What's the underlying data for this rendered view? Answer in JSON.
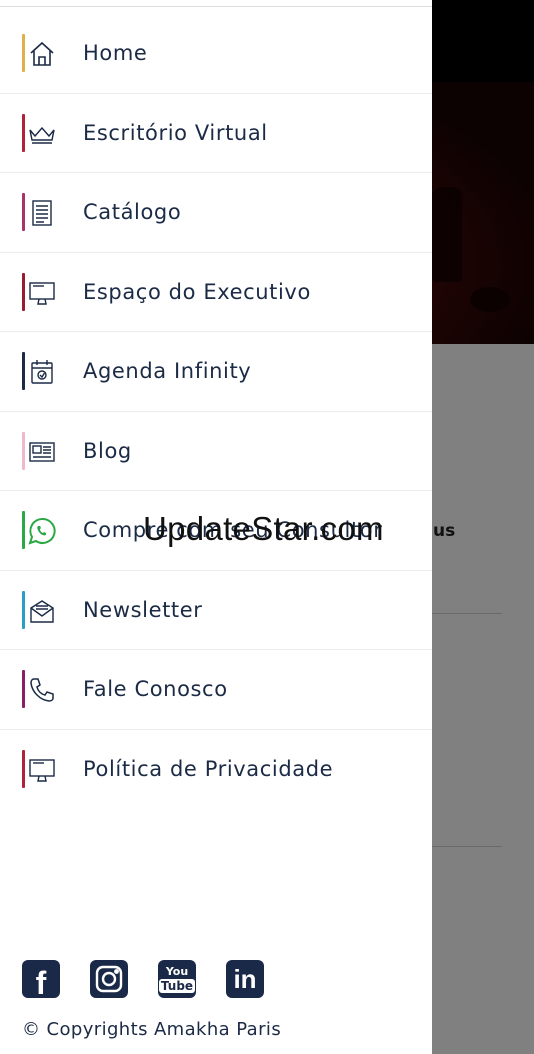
{
  "menu": {
    "items": [
      {
        "label": "Home",
        "icon": "home-icon",
        "color": "#e2b04a"
      },
      {
        "label": "Escritório Virtual",
        "icon": "crown-icon",
        "color": "#b0223a"
      },
      {
        "label": "Catálogo",
        "icon": "catalog-icon",
        "color": "#a8336a"
      },
      {
        "label": "Espaço do Executivo",
        "icon": "monitor-icon",
        "color": "#9b1a2e"
      },
      {
        "label": "Agenda Infinity",
        "icon": "calendar-icon",
        "color": "#1b2a45"
      },
      {
        "label": "Blog",
        "icon": "newspaper-icon",
        "color": "#f0b8cc"
      },
      {
        "label": "Compre com seu Consultor",
        "icon": "whatsapp-icon",
        "color": "#2aa845"
      },
      {
        "label": "Newsletter",
        "icon": "envelope-icon",
        "color": "#2a9fc4"
      },
      {
        "label": "Fale Conosco",
        "icon": "phone-icon",
        "color": "#8a1e6a"
      },
      {
        "label": "Política de Privacidade",
        "icon": "monitor-icon",
        "color": "#b0223a"
      }
    ]
  },
  "social": {
    "icons": [
      "facebook-icon",
      "instagram-icon",
      "youtube-icon",
      "linkedin-icon"
    ],
    "youtube_text_top": "You",
    "youtube_text_bottom": "Tube",
    "linkedin_text": "in",
    "facebook_text": "f"
  },
  "footer": {
    "copyright": "© Copyrights Amakha Paris"
  },
  "background": {
    "partial_text": "us"
  },
  "watermark": "UpdateStar.com",
  "colors": {
    "navy": "#1b2a45"
  }
}
